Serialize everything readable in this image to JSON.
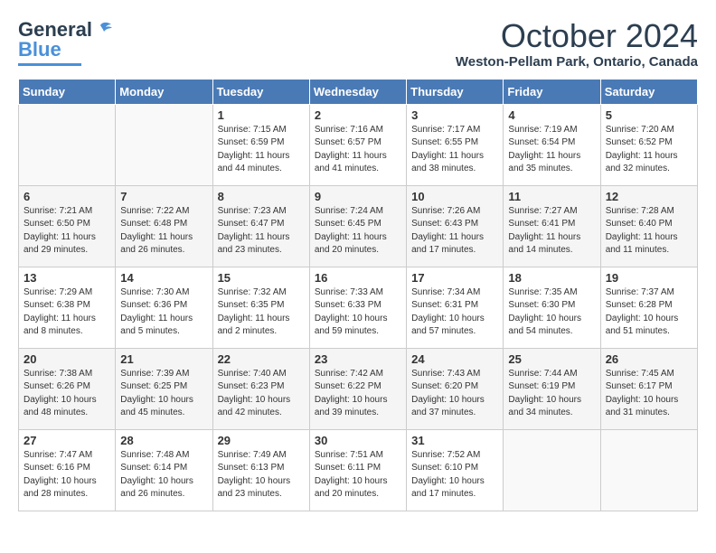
{
  "header": {
    "logo_general": "General",
    "logo_blue": "Blue",
    "month_title": "October 2024",
    "location": "Weston-Pellam Park, Ontario, Canada"
  },
  "days_of_week": [
    "Sunday",
    "Monday",
    "Tuesday",
    "Wednesday",
    "Thursday",
    "Friday",
    "Saturday"
  ],
  "weeks": [
    [
      {
        "num": "",
        "sunrise": "",
        "sunset": "",
        "daylight": ""
      },
      {
        "num": "",
        "sunrise": "",
        "sunset": "",
        "daylight": ""
      },
      {
        "num": "1",
        "sunrise": "Sunrise: 7:15 AM",
        "sunset": "Sunset: 6:59 PM",
        "daylight": "Daylight: 11 hours and 44 minutes."
      },
      {
        "num": "2",
        "sunrise": "Sunrise: 7:16 AM",
        "sunset": "Sunset: 6:57 PM",
        "daylight": "Daylight: 11 hours and 41 minutes."
      },
      {
        "num": "3",
        "sunrise": "Sunrise: 7:17 AM",
        "sunset": "Sunset: 6:55 PM",
        "daylight": "Daylight: 11 hours and 38 minutes."
      },
      {
        "num": "4",
        "sunrise": "Sunrise: 7:19 AM",
        "sunset": "Sunset: 6:54 PM",
        "daylight": "Daylight: 11 hours and 35 minutes."
      },
      {
        "num": "5",
        "sunrise": "Sunrise: 7:20 AM",
        "sunset": "Sunset: 6:52 PM",
        "daylight": "Daylight: 11 hours and 32 minutes."
      }
    ],
    [
      {
        "num": "6",
        "sunrise": "Sunrise: 7:21 AM",
        "sunset": "Sunset: 6:50 PM",
        "daylight": "Daylight: 11 hours and 29 minutes."
      },
      {
        "num": "7",
        "sunrise": "Sunrise: 7:22 AM",
        "sunset": "Sunset: 6:48 PM",
        "daylight": "Daylight: 11 hours and 26 minutes."
      },
      {
        "num": "8",
        "sunrise": "Sunrise: 7:23 AM",
        "sunset": "Sunset: 6:47 PM",
        "daylight": "Daylight: 11 hours and 23 minutes."
      },
      {
        "num": "9",
        "sunrise": "Sunrise: 7:24 AM",
        "sunset": "Sunset: 6:45 PM",
        "daylight": "Daylight: 11 hours and 20 minutes."
      },
      {
        "num": "10",
        "sunrise": "Sunrise: 7:26 AM",
        "sunset": "Sunset: 6:43 PM",
        "daylight": "Daylight: 11 hours and 17 minutes."
      },
      {
        "num": "11",
        "sunrise": "Sunrise: 7:27 AM",
        "sunset": "Sunset: 6:41 PM",
        "daylight": "Daylight: 11 hours and 14 minutes."
      },
      {
        "num": "12",
        "sunrise": "Sunrise: 7:28 AM",
        "sunset": "Sunset: 6:40 PM",
        "daylight": "Daylight: 11 hours and 11 minutes."
      }
    ],
    [
      {
        "num": "13",
        "sunrise": "Sunrise: 7:29 AM",
        "sunset": "Sunset: 6:38 PM",
        "daylight": "Daylight: 11 hours and 8 minutes."
      },
      {
        "num": "14",
        "sunrise": "Sunrise: 7:30 AM",
        "sunset": "Sunset: 6:36 PM",
        "daylight": "Daylight: 11 hours and 5 minutes."
      },
      {
        "num": "15",
        "sunrise": "Sunrise: 7:32 AM",
        "sunset": "Sunset: 6:35 PM",
        "daylight": "Daylight: 11 hours and 2 minutes."
      },
      {
        "num": "16",
        "sunrise": "Sunrise: 7:33 AM",
        "sunset": "Sunset: 6:33 PM",
        "daylight": "Daylight: 10 hours and 59 minutes."
      },
      {
        "num": "17",
        "sunrise": "Sunrise: 7:34 AM",
        "sunset": "Sunset: 6:31 PM",
        "daylight": "Daylight: 10 hours and 57 minutes."
      },
      {
        "num": "18",
        "sunrise": "Sunrise: 7:35 AM",
        "sunset": "Sunset: 6:30 PM",
        "daylight": "Daylight: 10 hours and 54 minutes."
      },
      {
        "num": "19",
        "sunrise": "Sunrise: 7:37 AM",
        "sunset": "Sunset: 6:28 PM",
        "daylight": "Daylight: 10 hours and 51 minutes."
      }
    ],
    [
      {
        "num": "20",
        "sunrise": "Sunrise: 7:38 AM",
        "sunset": "Sunset: 6:26 PM",
        "daylight": "Daylight: 10 hours and 48 minutes."
      },
      {
        "num": "21",
        "sunrise": "Sunrise: 7:39 AM",
        "sunset": "Sunset: 6:25 PM",
        "daylight": "Daylight: 10 hours and 45 minutes."
      },
      {
        "num": "22",
        "sunrise": "Sunrise: 7:40 AM",
        "sunset": "Sunset: 6:23 PM",
        "daylight": "Daylight: 10 hours and 42 minutes."
      },
      {
        "num": "23",
        "sunrise": "Sunrise: 7:42 AM",
        "sunset": "Sunset: 6:22 PM",
        "daylight": "Daylight: 10 hours and 39 minutes."
      },
      {
        "num": "24",
        "sunrise": "Sunrise: 7:43 AM",
        "sunset": "Sunset: 6:20 PM",
        "daylight": "Daylight: 10 hours and 37 minutes."
      },
      {
        "num": "25",
        "sunrise": "Sunrise: 7:44 AM",
        "sunset": "Sunset: 6:19 PM",
        "daylight": "Daylight: 10 hours and 34 minutes."
      },
      {
        "num": "26",
        "sunrise": "Sunrise: 7:45 AM",
        "sunset": "Sunset: 6:17 PM",
        "daylight": "Daylight: 10 hours and 31 minutes."
      }
    ],
    [
      {
        "num": "27",
        "sunrise": "Sunrise: 7:47 AM",
        "sunset": "Sunset: 6:16 PM",
        "daylight": "Daylight: 10 hours and 28 minutes."
      },
      {
        "num": "28",
        "sunrise": "Sunrise: 7:48 AM",
        "sunset": "Sunset: 6:14 PM",
        "daylight": "Daylight: 10 hours and 26 minutes."
      },
      {
        "num": "29",
        "sunrise": "Sunrise: 7:49 AM",
        "sunset": "Sunset: 6:13 PM",
        "daylight": "Daylight: 10 hours and 23 minutes."
      },
      {
        "num": "30",
        "sunrise": "Sunrise: 7:51 AM",
        "sunset": "Sunset: 6:11 PM",
        "daylight": "Daylight: 10 hours and 20 minutes."
      },
      {
        "num": "31",
        "sunrise": "Sunrise: 7:52 AM",
        "sunset": "Sunset: 6:10 PM",
        "daylight": "Daylight: 10 hours and 17 minutes."
      },
      {
        "num": "",
        "sunrise": "",
        "sunset": "",
        "daylight": ""
      },
      {
        "num": "",
        "sunrise": "",
        "sunset": "",
        "daylight": ""
      }
    ]
  ]
}
